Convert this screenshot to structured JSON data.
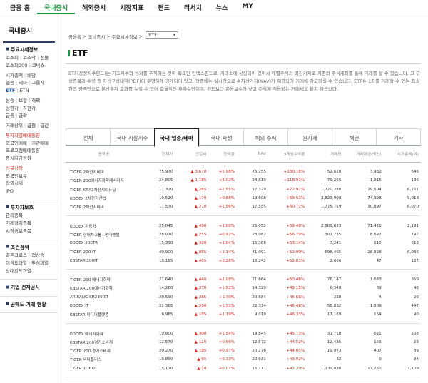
{
  "topnav": [
    "금융 홈",
    "국내증시",
    "해외증시",
    "시장지표",
    "펀드",
    "리서치",
    "뉴스",
    "MY"
  ],
  "lnb": {
    "title": "국내증시",
    "s1": {
      "head": "주요시세정보",
      "rows": [
        [
          "코스피",
          "코스닥",
          "선물"
        ],
        [
          "코스피200",
          "코넥스"
        ],
        [
          "시가총액",
          "배당"
        ],
        [
          "업종",
          "테마",
          "그룹사"
        ],
        [
          "ETF",
          "ETN"
        ],
        [
          "상승",
          "보합",
          "하락"
        ],
        [
          "상한가",
          "하한가"
        ],
        [
          "급등",
          "급락"
        ],
        [
          "거래상위",
          "급증",
          "급감"
        ],
        [
          "투자자별매매동향"
        ],
        [
          "외국인매매",
          "기관매매"
        ],
        [
          "프로그램매매동향"
        ],
        [
          "증시자금동향"
        ],
        [
          "신규상장"
        ],
        [
          "외국인보유"
        ],
        [
          "장외시세"
        ],
        [
          "IPO"
        ]
      ]
    },
    "s2": {
      "head": "투자자보호",
      "rows": [
        [
          "관리종목"
        ],
        [
          "거래정지종목"
        ],
        [
          "시장경보종목"
        ]
      ]
    },
    "s3": {
      "head": "조건검색",
      "rows": [
        [
          "골든크로스",
          "갭상승"
        ],
        [
          "이격도과열",
          "투심과열"
        ],
        [
          "상대강도과열"
        ]
      ]
    },
    "b1": "기업 전자공시",
    "b2": "공매도 거래 현황"
  },
  "breadcrumb": {
    "a": "금융홈",
    "b": "국내증시",
    "c": "주요시세정보",
    "select": "ETF",
    "sep": ">",
    "caret": "▾"
  },
  "title": "ETF",
  "desc": "ETF(상장지수펀드)는 기초지수의 성과를 추적하는 것이 목표인 인덱스펀드로, 거래소에 상장되어 있어서 개별주식과 마찬가지로 기존의 주식계좌를 통해 거래를 할 수 있습니다. 그 구성종목과 수량 등 자산구성내역(PDF)이 투명하게 공개되어 있고, 장중에는 실시간으로 순자산가치(NAV)가 제공되어 거래에 참고하실 수 있습니다. ETF는 1좌를 거래할 수 있는 최소한의 금액만으로 분산투자 효과를 누릴 수 있어 효율적인 투자수단이며, 펀드보다 운용보수가 낮고 주식에 적용되는 거래세도 붙지 않습니다.",
  "tabs": [
    "전체",
    "국내 시장지수",
    "국내 업종/테마",
    "국내 파생",
    "해외 주식",
    "원자재",
    "채권",
    "기타"
  ],
  "table": {
    "headers": [
      "종목명",
      "현재가",
      "전일비",
      "등락률",
      "NAV",
      "3개월수익률",
      "거래량",
      "거래대금(백만)",
      "시가총액(억)"
    ],
    "groups": [
      [
        [
          "TIGER 2차전지테마",
          "75,970",
          "▲ 3,670",
          "+5.08%",
          "76,255",
          "+130.18%",
          "52,620",
          "3,932",
          "646"
        ],
        [
          "TIGER 200에너지화학레버리지",
          "24,805",
          "▲ 1,185",
          "+5.02%",
          "24,819",
          "+118.91%",
          "79,255",
          "1,915",
          "186"
        ],
        [
          "TIGER KRX2차전지K-뉴딜",
          "17,320",
          "▲ 265",
          "+1.55%",
          "17,329",
          "+72.97%",
          "1,720,280",
          "29,504",
          "6,157"
        ],
        [
          "KODEX 2차전지산업",
          "19,520",
          "▲ 170",
          "+0.88%",
          "19,608",
          "+69.51%",
          "3,823,908",
          "74,398",
          "9,018"
        ],
        [
          "TIGER 2차전지테마",
          "17,570",
          "▲ 270",
          "+1.56%",
          "17,555",
          "+60.71%",
          "1,775,759",
          "30,897",
          "6,070"
        ]
      ],
      [
        [
          "KODEX 자동차",
          "25,045",
          "▲ 490",
          "+2.00%",
          "25,052",
          "+59.40%",
          "2,809,633",
          "71,421",
          "2,191"
        ],
        [
          "TIGER 현대차그룹+펀더멘털",
          "28,070",
          "▲ 255",
          "+0.92%",
          "28,062",
          "+56.79%",
          "301,235",
          "8,697",
          "792"
        ],
        [
          "KODEX 200TR",
          "15,330",
          "▲ 320",
          "+2.04%",
          "15,388",
          "+53.14%",
          "7,241",
          "110",
          "613"
        ],
        [
          "TIGER 200 IT",
          "40,900",
          "▲ 855",
          "+2.14%",
          "41,091",
          "+52.99%",
          "698,465",
          "28,328",
          "6,086"
        ],
        [
          "KBSTAR 200IT",
          "18,185",
          "▲ 405",
          "+2.28%",
          "18,242",
          "+52.03%",
          "2,606",
          "47",
          "127"
        ]
      ],
      [
        [
          "TIGER 200 에너지화학",
          "21,640",
          "▲ 440",
          "+2.08%",
          "21,664",
          "+50.46%",
          "76,147",
          "1,633",
          "359"
        ],
        [
          "KBSTAR 200에너지화학",
          "14,260",
          "▲ 270",
          "+1.93%",
          "14,329",
          "+49.15%",
          "6,348",
          "89",
          "48"
        ],
        [
          "ARIRANG KRX300IT",
          "20,590",
          "▲ 285",
          "+1.40%",
          "20,684",
          "+46.66%",
          "228",
          "4",
          "29"
        ],
        [
          "KODEX IT",
          "22,365",
          "▲ 290",
          "+1.31%",
          "22,374",
          "+46.48%",
          "58,852",
          "1,309",
          "447"
        ],
        [
          "KBSTAR 미디어플랫폼",
          "8,965",
          "▲ 105",
          "+1.19%",
          "9,010",
          "+46.33%",
          "17,169",
          "154",
          "90"
        ]
      ],
      [
        [
          "KODEX 에너지화학",
          "19,800",
          "▲ 300",
          "+1.54%",
          "19,845",
          "+45.73%",
          "31,718",
          "621",
          "208"
        ],
        [
          "KBSTAR 200경기소비재",
          "12,570",
          "▲ 120",
          "+0.96%",
          "12,572",
          "+44.52%",
          "12,435",
          "159",
          "23"
        ],
        [
          "TIGER 200 경기소비재",
          "20,270",
          "▲ 195",
          "+0.97%",
          "20,276",
          "+44.05%",
          "19,973",
          "407",
          "89"
        ],
        [
          "TIGER 비타플러스",
          "19,890",
          "▲ 65",
          "+0.33%",
          "20,031",
          "+43.92%",
          "32",
          "0",
          "84"
        ],
        [
          "TIGER TOP10",
          "15,110",
          "▲ 10",
          "+0.07%",
          "15,111",
          "+43.20%",
          "1,139,030",
          "17,250",
          "7,109"
        ]
      ]
    ]
  }
}
